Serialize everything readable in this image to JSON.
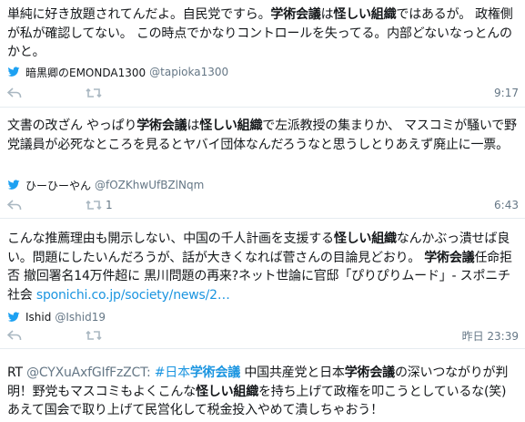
{
  "tweets": [
    {
      "segments": [
        {
          "t": "単純に好き放題されてんだよ。自民党ですら。"
        },
        {
          "t": "学術会議",
          "b": true
        },
        {
          "t": "は"
        },
        {
          "t": "怪しい組織",
          "b": true
        },
        {
          "t": "ではあるが。 政権側が私が確認してない。 この時点でかなりコントロールを失ってる。内部どないなっとんのかと。"
        }
      ],
      "author_name": "暗黒卿のEMONDA1300",
      "author_handle": "@tapioka1300",
      "retweet_count": "",
      "time": "9:17"
    },
    {
      "segments": [
        {
          "t": "文書の改ざん やっぱり"
        },
        {
          "t": "学術会議",
          "b": true
        },
        {
          "t": "は"
        },
        {
          "t": "怪しい組織",
          "b": true
        },
        {
          "t": "で左派教授の集まりか、 マスコミが騒いで野党議員が必死なところを見るとヤバイ団体なんだろうなと思うしとりあえず廃止に一票。"
        }
      ],
      "author_name": "ひーひーやん",
      "author_handle": "@fOZKhwUfBZlNqm",
      "retweet_count": "1",
      "time": "6:43"
    },
    {
      "segments": [
        {
          "t": "こんな推薦理由も開示しない、中国の千人計画を支援する"
        },
        {
          "t": "怪しい組織",
          "b": true
        },
        {
          "t": "なんかぶっ潰せば良い。問題にしたいんだろうが、話が大きくなれば菅さんの目論見どおり。 "
        },
        {
          "t": "学術会議",
          "b": true
        },
        {
          "t": "任命拒否 撤回署名14万件超に 黒川問題の再来?ネット世論に官邸「ぴりぴりムード」- スポニチ社会 "
        },
        {
          "t": "sponichi.co.jp/society/news/2…",
          "link": true
        }
      ],
      "author_name": "Ishid",
      "author_handle": "@Ishid19",
      "retweet_count": "",
      "time": "昨日 23:39"
    },
    {
      "segments": [
        {
          "t": "RT "
        },
        {
          "t": "@CYXuAxfGIfFzZCT:",
          "muted": true
        },
        {
          "t": " "
        },
        {
          "t": "#日本",
          "link": true
        },
        {
          "t": "学術会議",
          "link": true,
          "b": true
        },
        {
          "t": " 中国共産党と日本"
        },
        {
          "t": "学術会議",
          "b": true
        },
        {
          "t": "の深いつながりが判明！野党もマスコミもよくこんな"
        },
        {
          "t": "怪しい組織",
          "b": true
        },
        {
          "t": "を持ち上げて政権を叩こうとしているな(笑) あえて国会で取り上げて民営化して税金投入やめて潰しちゃおう！"
        }
      ],
      "author_name": "",
      "author_handle": "",
      "retweet_count": "",
      "time": ""
    }
  ],
  "colors": {
    "accent": "#1da1f2",
    "link": "#1b95e0",
    "muted": "#657786",
    "border": "#e6ecf0"
  },
  "icons": {
    "bird": "twitter-bird-icon",
    "reply": "reply-icon",
    "retweet": "retweet-icon"
  }
}
